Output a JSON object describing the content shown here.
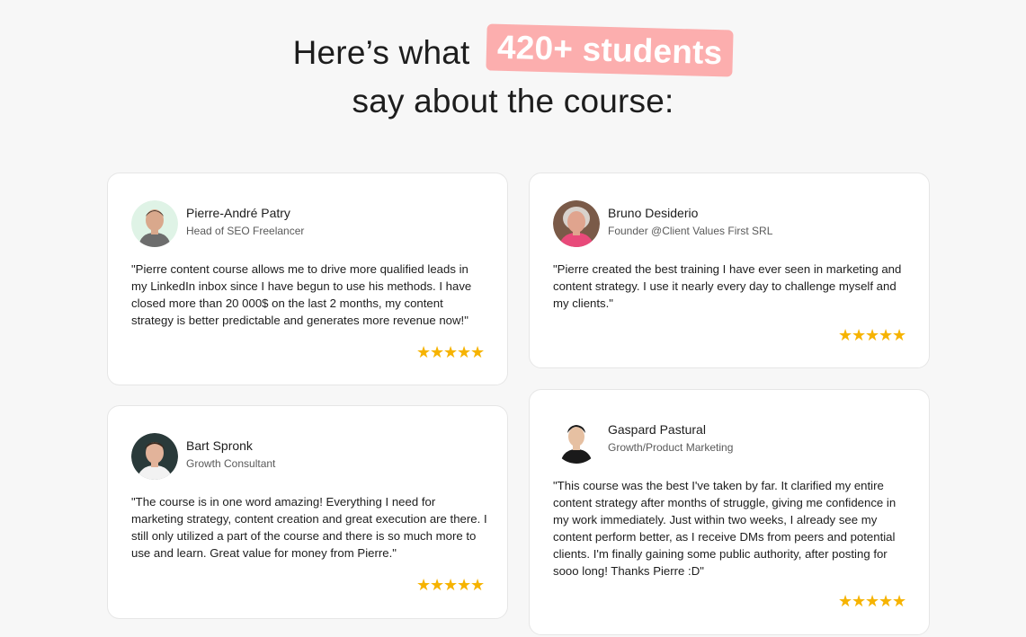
{
  "headline": {
    "prefix": "Here’s what",
    "highlight": "420+ students",
    "suffix": "say about the course:"
  },
  "colors": {
    "highlight_bg": "#fcaeae",
    "star": "#f6b300",
    "background": "#f7f7f7",
    "card": "#ffffff"
  },
  "testimonials": [
    {
      "name": "Pierre-André Patry",
      "role": "Head of SEO Freelancer",
      "quote": "\"Pierre content course allows me to drive more qualified leads in my LinkedIn inbox since I have begun to use his methods. I have closed more than 20 000$ on the last 2 months, my content strategy is better predictable and generates more revenue now!\"",
      "rating": 5
    },
    {
      "name": "Bruno Desiderio",
      "role": "Founder @Client Values First SRL",
      "quote": "\"Pierre created the best training I have ever seen in marketing and content strategy. I use it nearly every day to challenge myself and my clients.\"",
      "rating": 5
    },
    {
      "name": "Bart Spronk",
      "role": "Growth Consultant",
      "quote": "\"The course is in one word amazing! Everything I need for marketing strategy, content creation and great execution are there. I still only utilized a part of the course and there is so much more to use and learn. Great value for money from Pierre.\"",
      "rating": 5
    },
    {
      "name": "Gaspard Pastural",
      "role": "Growth/Product Marketing",
      "quote": "\"This course was the best I've taken by far. It clarified my entire content strategy after months of struggle, giving me confidence in my work immediately. Just within two weeks, I already see my content perform better, as I receive DMs from peers and potential clients. I'm finally gaining some public authority, after posting for sooo long! Thanks Pierre :D\"",
      "rating": 5
    }
  ]
}
